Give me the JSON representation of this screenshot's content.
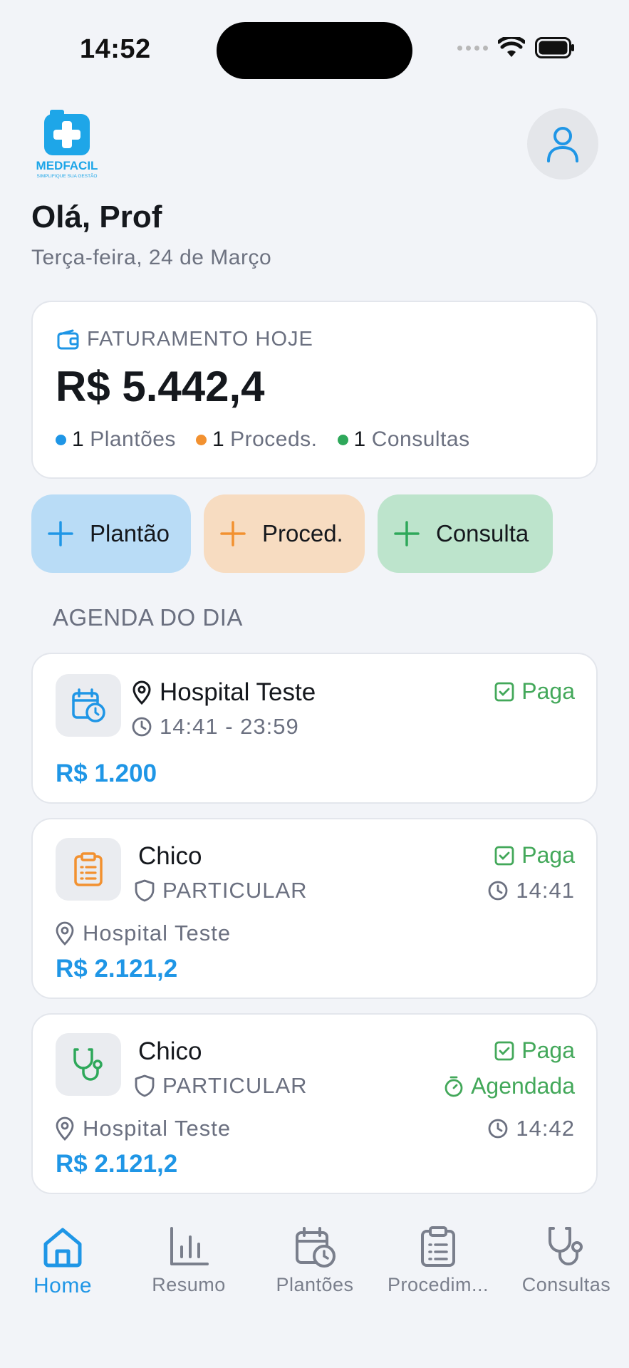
{
  "status_bar": {
    "time": "14:52"
  },
  "header": {
    "logo_text": "MEDFACIL",
    "logo_tagline": "SIMPLIFIQUE SUA GESTÃO",
    "greeting": "Olá, Prof",
    "date": "Terça-feira, 24 de Março"
  },
  "revenue": {
    "label": "FATURAMENTO HOJE",
    "value": "R$ 5.442,4",
    "stats": [
      {
        "count": "1",
        "label": "Plantões",
        "color": "#1f96e6"
      },
      {
        "count": "1",
        "label": "Proceds.",
        "color": "#f29130"
      },
      {
        "count": "1",
        "label": "Consultas",
        "color": "#2ea85a"
      }
    ]
  },
  "quick_actions": [
    {
      "label": "Plantão",
      "bg": "#b9dcf6",
      "color": "#1f96e6"
    },
    {
      "label": "Proced.",
      "bg": "#f7dcc1",
      "color": "#f29130"
    },
    {
      "label": "Consulta",
      "bg": "#bde4cc",
      "color": "#2ea85a"
    }
  ],
  "agenda": {
    "title": "AGENDA DO DIA",
    "items": [
      {
        "type": "plantao",
        "title": "Hospital Teste",
        "time_range": "14:41 - 23:59",
        "status": "Paga",
        "price": "R$ 1.200"
      },
      {
        "type": "procedimento",
        "title": "Chico",
        "insurance": "PARTICULAR",
        "status": "Paga",
        "time": "14:41",
        "location": "Hospital Teste",
        "price": "R$ 2.121,2"
      },
      {
        "type": "consulta",
        "title": "Chico",
        "insurance": "PARTICULAR",
        "status": "Paga",
        "schedule_status": "Agendada",
        "time": "14:42",
        "location": "Hospital Teste",
        "price": "R$ 2.121,2"
      }
    ]
  },
  "nav": [
    {
      "label": "Home",
      "icon": "home-icon",
      "active": true
    },
    {
      "label": "Resumo",
      "icon": "bar-chart-icon"
    },
    {
      "label": "Plantões",
      "icon": "calendar-clock-icon"
    },
    {
      "label": "Procedim...",
      "icon": "clipboard-icon"
    },
    {
      "label": "Consultas",
      "icon": "stethoscope-icon"
    }
  ],
  "colors": {
    "accent": "#1f96e6",
    "orange": "#f29130",
    "green": "#2ea85a",
    "paid_green": "#43a85a"
  }
}
